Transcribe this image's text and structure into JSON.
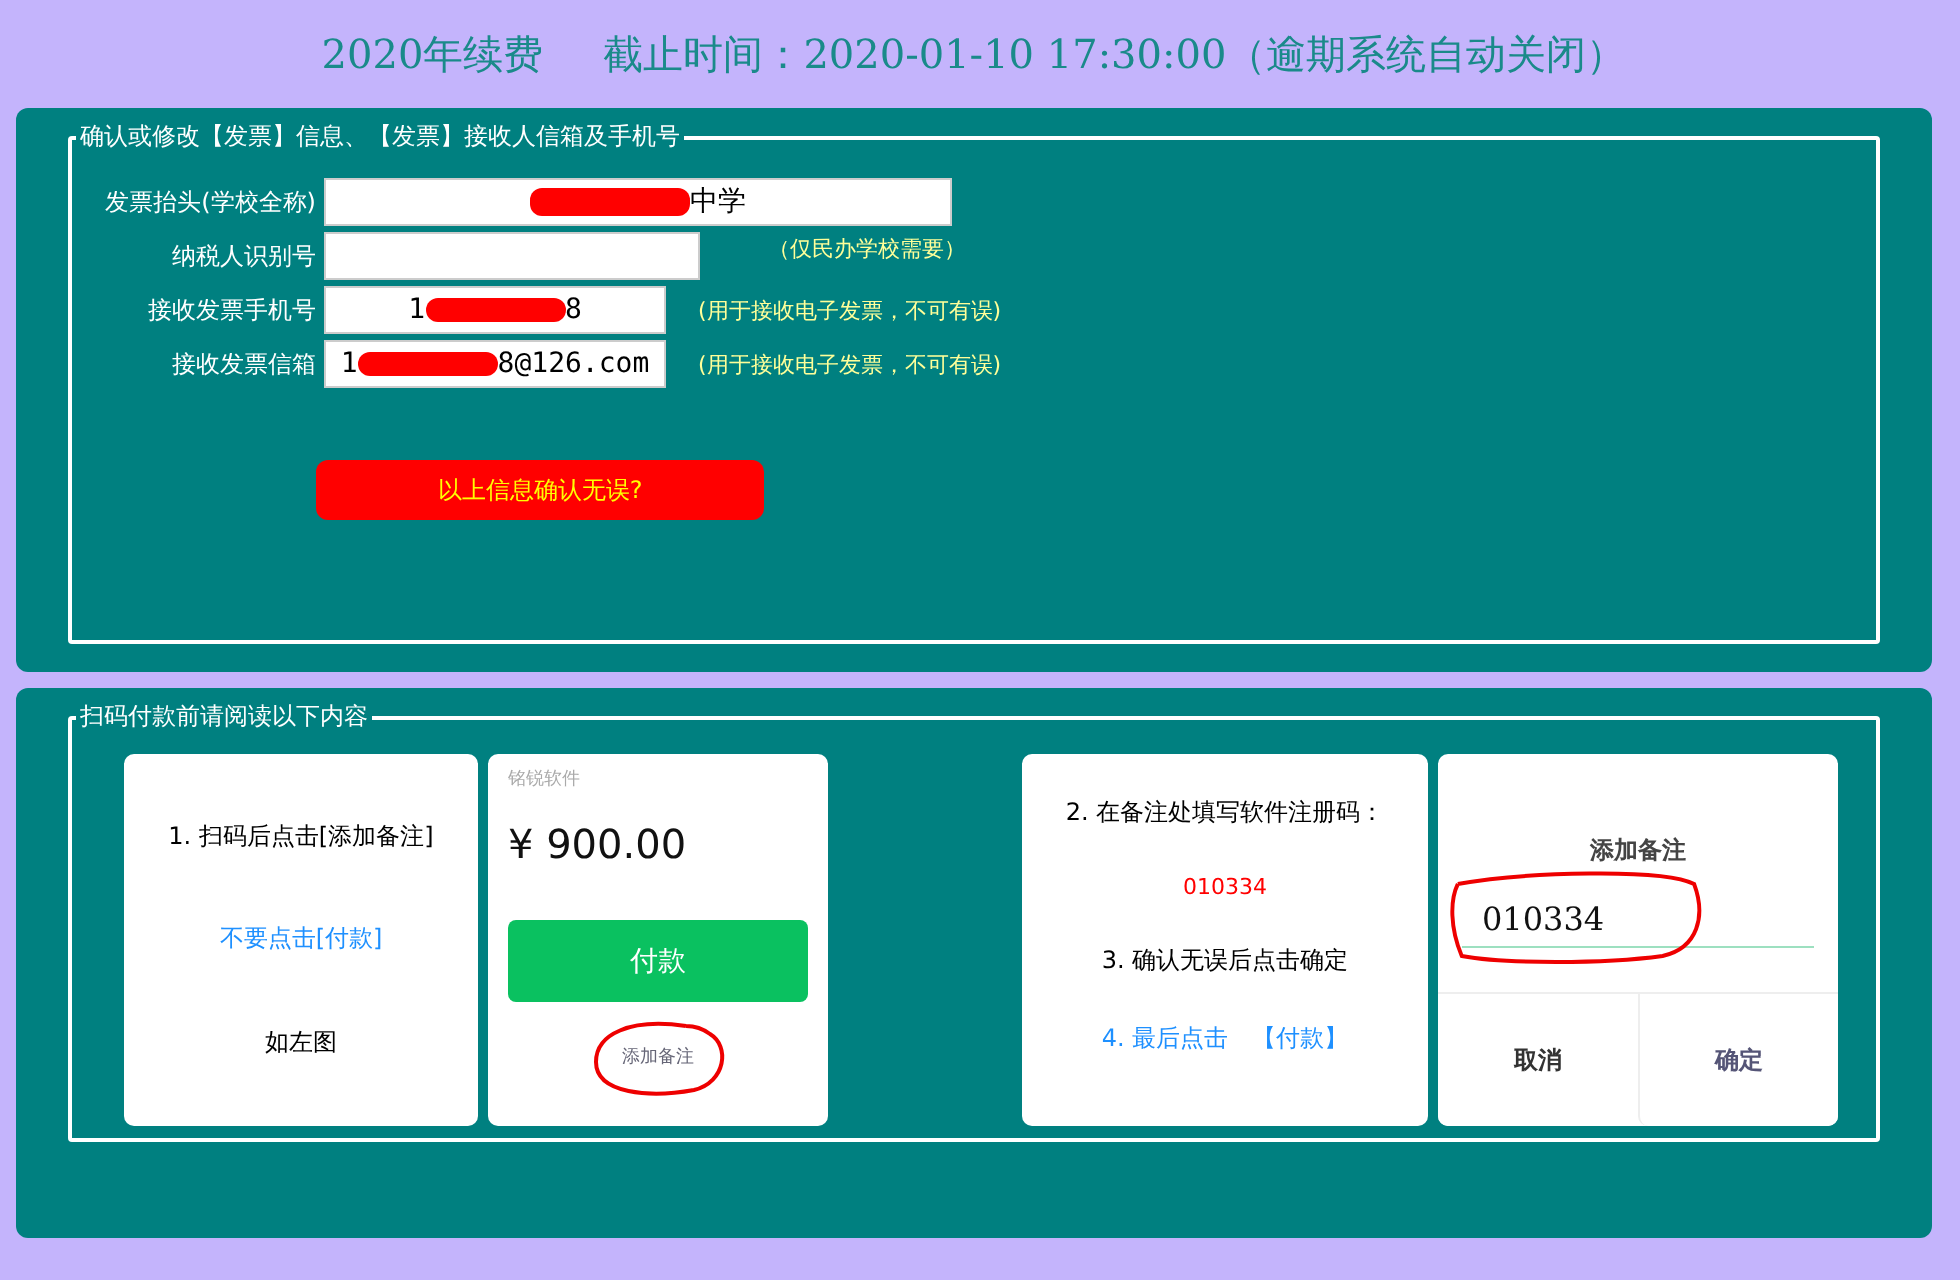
{
  "header": {
    "year_label": "2020年续费",
    "deadline": "截止时间：2020-01-10  17:30:00（逾期系统自动关闭）"
  },
  "invoice_section": {
    "legend": "确认或修改【发票】信息、【发票】接收人信箱及手机号",
    "fields": [
      {
        "label": "发票抬头(学校全称)",
        "value_end": "中学",
        "redacted": true
      },
      {
        "label": "纳税人识别号",
        "redacted": false,
        "hint": "（仅民办学校需要）"
      },
      {
        "label": "接收发票手机号",
        "value_start": "1",
        "value_end": "8",
        "redacted": true,
        "hint": "(用于接收电子发票，不可有误)"
      },
      {
        "label": "接收发票信箱",
        "value_start": "1",
        "value_end": "8@126.com",
        "redacted": true,
        "hint": "(用于接收电子发票，不可有误)"
      }
    ],
    "confirm_button": "以上信息确认无误?"
  },
  "payment_section": {
    "legend": "扫码付款前请阅读以下内容",
    "steps_left": [
      {
        "kind": "normal",
        "text": "1.  扫码后点击[添加备注]"
      },
      {
        "kind": "link",
        "text": "不要点击[付款]"
      },
      {
        "kind": "normal",
        "text": "如左图"
      }
    ],
    "pay_screen": {
      "merchant": "铭锐软件",
      "amount": "¥ 900.00",
      "pay_button": "付款",
      "note_link": "添加备注"
    },
    "steps_right": [
      {
        "kind": "normal",
        "text": "2.  在备注处填写软件注册码："
      },
      {
        "kind": "code",
        "text": "010334"
      },
      {
        "kind": "normal",
        "text": "3.  确认无误后点击确定"
      },
      {
        "kind": "link",
        "text": "4.  最后点击　【付款】"
      }
    ],
    "note_dialog": {
      "title": "添加备注",
      "value": "010334",
      "cancel": "取消",
      "ok": "确定"
    }
  }
}
